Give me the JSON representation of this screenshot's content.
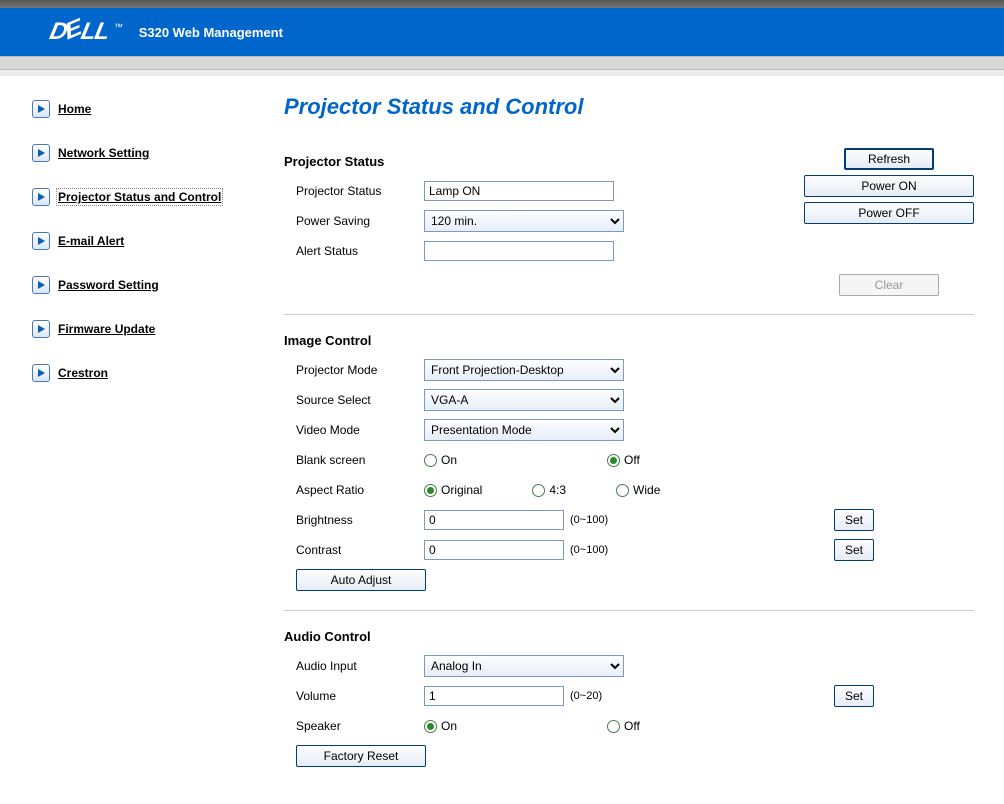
{
  "header": {
    "logo_text": "DELL",
    "subtitle": "S320 Web Management"
  },
  "sidebar": {
    "items": [
      {
        "label": "Home"
      },
      {
        "label": "Network Setting"
      },
      {
        "label": "Projector Status and Control"
      },
      {
        "label": "E-mail Alert"
      },
      {
        "label": "Password Setting"
      },
      {
        "label": "Firmware Update"
      },
      {
        "label": "Crestron"
      }
    ]
  },
  "page_title": "Projector Status and Control",
  "status": {
    "section": "Projector Status",
    "projector_status_label": "Projector Status",
    "projector_status_value": "Lamp ON",
    "power_saving_label": "Power Saving",
    "power_saving_value": "120 min.",
    "alert_status_label": "Alert Status",
    "alert_status_value": "",
    "refresh_btn": "Refresh",
    "power_on_btn": "Power ON",
    "power_off_btn": "Power OFF",
    "clear_btn": "Clear"
  },
  "image": {
    "section": "Image Control",
    "projector_mode_label": "Projector Mode",
    "projector_mode_value": "Front Projection-Desktop",
    "source_select_label": "Source Select",
    "source_select_value": "VGA-A",
    "video_mode_label": "Video Mode",
    "video_mode_value": "Presentation Mode",
    "blank_screen_label": "Blank screen",
    "on_label": "On",
    "off_label": "Off",
    "blank_screen_value": "Off",
    "aspect_ratio_label": "Aspect Ratio",
    "aspect_original": "Original",
    "aspect_43": "4:3",
    "aspect_wide": "Wide",
    "aspect_ratio_value": "Original",
    "brightness_label": "Brightness",
    "brightness_value": "0",
    "brightness_range": "(0~100)",
    "contrast_label": "Contrast",
    "contrast_value": "0",
    "contrast_range": "(0~100)",
    "set_btn": "Set",
    "auto_adjust_btn": "Auto Adjust"
  },
  "audio": {
    "section": "Audio Control",
    "audio_input_label": "Audio Input",
    "audio_input_value": "Analog In",
    "volume_label": "Volume",
    "volume_value": "1",
    "volume_range": "(0~20)",
    "speaker_label": "Speaker",
    "on_label": "On",
    "off_label": "Off",
    "speaker_value": "On",
    "set_btn": "Set",
    "factory_reset_btn": "Factory Reset"
  }
}
